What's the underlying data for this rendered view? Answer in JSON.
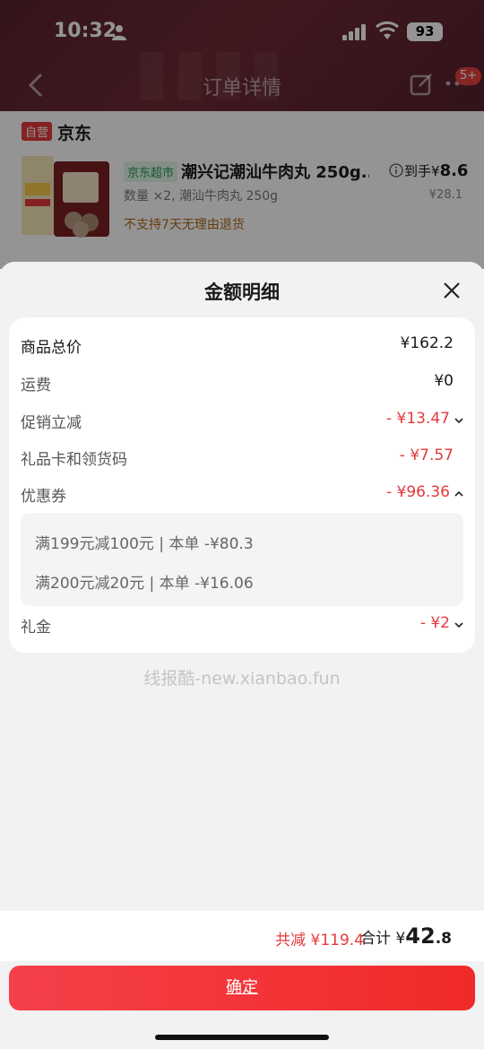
{
  "status_bar": {
    "time": "10:32",
    "battery": "93"
  },
  "header": {
    "title": "订单详情",
    "badge": "5+"
  },
  "shop": {
    "tag": "自营",
    "name": "京东"
  },
  "product": {
    "tag": "京东超市",
    "name": "潮兴记潮汕牛肉丸 250g...",
    "daoshou_label": "到手",
    "daoshou_symbol": "¥",
    "daoshou_price": "8.6",
    "spec": "数量 ×2, 潮汕牛肉丸 250g",
    "original_price": "¥28.1",
    "return_policy": "不支持7天无理由退货"
  },
  "sheet": {
    "title": "金额明细",
    "rows": [
      {
        "label": "商品总价",
        "value": "¥162.2"
      },
      {
        "label": "运费",
        "value": "¥0"
      },
      {
        "label": "促销立减",
        "value": "- ¥13.47"
      },
      {
        "label": "礼品卡和领货码",
        "value": "- ¥7.57"
      },
      {
        "label": "优惠券",
        "value": "- ¥96.36"
      },
      {
        "label": "礼金",
        "value": "- ¥2"
      }
    ],
    "coupons": [
      "满199元减100元 | 本单 -¥80.3",
      "满200元减20元 | 本单 -¥16.06"
    ],
    "watermark": "线报酷-new.xianbao.fun"
  },
  "footer": {
    "save": "共减 ¥119.4",
    "total_label": "合计 ¥",
    "total_int": "42",
    "total_dec": ".8",
    "confirm": "确定"
  },
  "colors": {
    "accent_red": "#e4393c",
    "header_bg": "#6e2b35",
    "jd_green": "#1e9b4f"
  }
}
